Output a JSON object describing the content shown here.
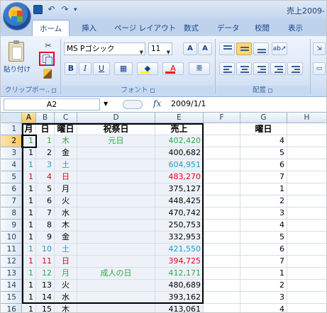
{
  "window": {
    "title": "売上2009-",
    "active_tab": "ホーム",
    "tabs": [
      "ホーム",
      "挿入",
      "ページ レイアウト",
      "数式",
      "データ",
      "校閲",
      "表示"
    ]
  },
  "ribbon": {
    "paste_label": "貼り付け",
    "cut_label": "✂",
    "clipboard_group_label": "クリップボー..",
    "font_group_label": "フォント",
    "alignment_group_label": "配置",
    "font_name": "MS Pゴシック",
    "font_size": "11",
    "grow_label": "A",
    "shrink_label": "A",
    "bold_label": "B",
    "italic_label": "I",
    "underline_label": "U",
    "fill_label": "◆",
    "fontcolor_label": "A",
    "phonetic_label": "亜",
    "highlighted_button": "copy",
    "fill_color": "#ffff00",
    "font_color": "#ff0000"
  },
  "formula_bar": {
    "name_box": "A2",
    "fx_label": "fx",
    "formula": "2009/1/1"
  },
  "sheet": {
    "columns": [
      "A",
      "B",
      "C",
      "D",
      "E",
      "F",
      "G",
      "H"
    ],
    "selected_column": "A",
    "selected_row": 2,
    "row_numbers": [
      "1",
      "2",
      "3",
      "4",
      "5",
      "6",
      "7",
      "8",
      "9",
      "10",
      "11",
      "12",
      "13",
      "14",
      "15",
      "16"
    ],
    "header_row": {
      "A": "月",
      "B": "日",
      "C": "曜日",
      "D": "祝祭日",
      "E": "売上",
      "G": "曜日"
    },
    "colors": {
      "green": "#2aa84a",
      "blue": "#1a9ad6",
      "red": "#e8001c",
      "black": "#000000"
    },
    "rows": [
      {
        "A": "1",
        "B": "1",
        "C": "木",
        "D": "元日",
        "E": "402,420",
        "G": "4",
        "color": "green"
      },
      {
        "A": "1",
        "B": "2",
        "C": "金",
        "D": "",
        "E": "400,682",
        "G": "5",
        "color": "black"
      },
      {
        "A": "1",
        "B": "3",
        "C": "土",
        "D": "",
        "E": "604,951",
        "G": "6",
        "color": "blue"
      },
      {
        "A": "1",
        "B": "4",
        "C": "日",
        "D": "",
        "E": "483,270",
        "G": "7",
        "color": "red"
      },
      {
        "A": "1",
        "B": "5",
        "C": "月",
        "D": "",
        "E": "375,127",
        "G": "1",
        "color": "black"
      },
      {
        "A": "1",
        "B": "6",
        "C": "火",
        "D": "",
        "E": "448,425",
        "G": "2",
        "color": "black"
      },
      {
        "A": "1",
        "B": "7",
        "C": "水",
        "D": "",
        "E": "470,742",
        "G": "3",
        "color": "black"
      },
      {
        "A": "1",
        "B": "8",
        "C": "木",
        "D": "",
        "E": "250,753",
        "G": "4",
        "color": "black"
      },
      {
        "A": "1",
        "B": "9",
        "C": "金",
        "D": "",
        "E": "332,953",
        "G": "5",
        "color": "black"
      },
      {
        "A": "1",
        "B": "10",
        "C": "土",
        "D": "",
        "E": "421,550",
        "G": "6",
        "color": "blue"
      },
      {
        "A": "1",
        "B": "11",
        "C": "日",
        "D": "",
        "E": "394,725",
        "G": "7",
        "color": "red"
      },
      {
        "A": "1",
        "B": "12",
        "C": "月",
        "D": "成人の日",
        "E": "412,171",
        "G": "1",
        "color": "green"
      },
      {
        "A": "1",
        "B": "13",
        "C": "火",
        "D": "",
        "E": "480,689",
        "G": "2",
        "color": "black"
      },
      {
        "A": "1",
        "B": "14",
        "C": "水",
        "D": "",
        "E": "393,162",
        "G": "3",
        "color": "black"
      },
      {
        "A": "1",
        "B": "15",
        "C": "木",
        "D": "",
        "E": "413,061",
        "G": "4",
        "color": "black"
      }
    ]
  }
}
